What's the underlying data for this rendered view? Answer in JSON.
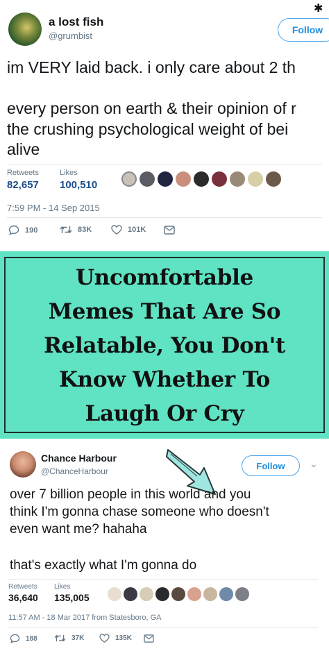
{
  "tweet1": {
    "name": "a lost fish",
    "handle": "@grumbist",
    "follow_label": "Follow",
    "lines": [
      "im VERY laid back. i only care about 2 th",
      "every person on earth & their opinion of r",
      "the crushing psychological weight of bei",
      "alive"
    ],
    "retweets_label": "Retweets",
    "retweets_value": "82,657",
    "likes_label": "Likes",
    "likes_value": "100,510",
    "timestamp": "7:59 PM - 14 Sep 2015",
    "reply_count": "190",
    "retweet_count": "83K",
    "like_count": "101K",
    "icons": [
      "reply-icon",
      "retweet-icon",
      "heart-icon",
      "dm-icon"
    ]
  },
  "banner": {
    "lines": [
      "Uncomfortable",
      "Memes That Are So",
      "Relatable, You Don't",
      "Know Whether To",
      "Laugh Or Cry"
    ],
    "background": "#5fe3c3"
  },
  "tweet2": {
    "name": "Chance Harbour",
    "handle": "@ChanceHarbour",
    "follow_label": "Follow",
    "lines": [
      "over 7 billion people in this world and you",
      "think I'm gonna chase someone who doesn't",
      "even want me? hahaha",
      "that's exactly what I'm gonna do"
    ],
    "retweets_label": "Retweets",
    "retweets_value": "36,640",
    "likes_label": "Likes",
    "likes_value": "135,005",
    "timestamp": "11:57 AM - 18 Mar 2017 from Statesboro, GA",
    "reply_count": "188",
    "retweet_count": "37K",
    "like_count": "135K",
    "icons": [
      "reply-icon",
      "retweet-icon",
      "heart-icon",
      "dm-icon"
    ]
  },
  "colors": {
    "link_blue": "#1d8fe0",
    "stat_blue": "#1b4e8c",
    "muted": "#657786",
    "arrow_fill": "#9fe6e1"
  }
}
